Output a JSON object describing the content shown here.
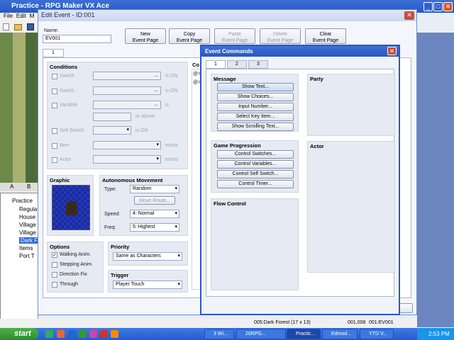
{
  "main": {
    "title": "Practice - RPG Maker VX Ace",
    "menu": [
      "File",
      "Edit",
      "M"
    ]
  },
  "tree": {
    "tabs": [
      "A",
      "B"
    ],
    "items": [
      "Practice",
      "Regula",
      "House",
      "Village",
      "Village",
      "Dark F",
      "Items",
      "Port T"
    ]
  },
  "edit": {
    "title": "Edit Event - ID:001",
    "close": "✕",
    "name_label": "Name:",
    "name_value": "EV001",
    "buttons": {
      "new": [
        "New",
        "Event Page"
      ],
      "copy": [
        "Copy",
        "Event Page"
      ],
      "paste": [
        "Paste",
        "Event Page"
      ],
      "delete": [
        "Delete",
        "Event Page"
      ],
      "clear": [
        "Clear",
        "Event Page"
      ]
    },
    "page_tab": "1",
    "conditions": {
      "title": "Conditions",
      "switch1": "Switch",
      "is_on1": "is ON",
      "switch2": "Switch",
      "is_on2": "is ON",
      "variable": "Variable",
      "is": "is",
      "or_above": "or above",
      "self_switch": "Self Switch",
      "is_on3": "is ON",
      "item": "Item",
      "exists1": "exists",
      "actor": "Actor",
      "exists2": "exists",
      "dots": "..."
    },
    "graphic": {
      "title": "Graphic"
    },
    "autonomous": {
      "title": "Autonomous Movement",
      "type_label": "Type:",
      "type_value": "Random",
      "move_route": "Move Route...",
      "speed_label": "Speed:",
      "speed_value": "4: Normal",
      "freq_label": "Freq:",
      "freq_value": "5: Highest"
    },
    "options": {
      "title": "Options",
      "walking": "Walking Anim.",
      "stepping": "Stepping Anim.",
      "direction": "Direction Fix",
      "through": "Through"
    },
    "priority": {
      "title": "Priority",
      "value": "Same as Characters"
    },
    "trigger": {
      "title": "Trigger",
      "value": "Player Touch"
    },
    "contents": {
      "title": "Co",
      "l1": "@>",
      "l2": "@>"
    }
  },
  "cmd": {
    "title": "Event Commands",
    "close": "✕",
    "tabs": [
      "1",
      "2",
      "3"
    ],
    "message": {
      "title": "Message",
      "items": [
        "Show Text...",
        "Show Choices...",
        "Input Number...",
        "Select Key Item...",
        "Show Scrolling Text..."
      ]
    },
    "game_progression": {
      "title": "Game Progression",
      "items": [
        "Control Switches...",
        "Control Variables...",
        "Control Self Switch...",
        "Control Timer..."
      ]
    },
    "flow": {
      "title": "Flow Control"
    },
    "party": {
      "title": "Party"
    },
    "actor": {
      "title": "Actor"
    }
  },
  "status": {
    "map": "005:Dark Forest (17 x 13)",
    "coords": "001,008",
    "event": "001:EV001"
  },
  "taskbar": {
    "start": "start",
    "tasks": [
      "3 Wi...",
      "20RPG...",
      "Practic...",
      "Edmod...",
      "YTD V..."
    ],
    "time": "2:53 PM"
  }
}
